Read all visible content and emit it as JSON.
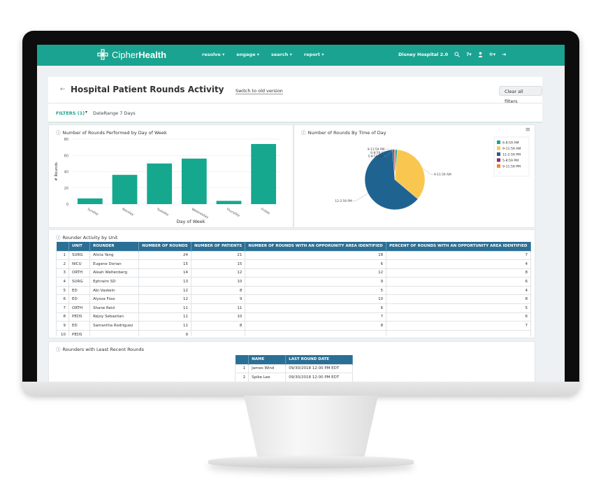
{
  "app": {
    "logo_prefix": "Cipher",
    "logo_suffix": "Health"
  },
  "nav": {
    "items": [
      "resolve ▾",
      "engage ▾",
      "search ▾",
      "report ▾"
    ],
    "org": "Disney Hospital 2.0"
  },
  "page": {
    "back_icon": "back-arrow-icon",
    "title": "Hospital Patient Rounds Activity",
    "switch_link": "Switch to old version",
    "clear_filters": "Clear all filters"
  },
  "filters": {
    "label": "FILTERS (1)",
    "daterange": "DateRange  7 Days"
  },
  "colors": {
    "brand": "#1aa390",
    "table_header": "#2a6f96"
  },
  "cards": {
    "day_of_week_title": "Number of Rounds Performed by Day of Week",
    "time_of_day_title": "Number of Rounds By Time of Day",
    "rounder_unit_title": "Rounder Activity by Unit",
    "least_recent_title": "Rounders with Least Recent Rounds"
  },
  "chart_data": [
    {
      "type": "bar",
      "title": "Number of Rounds Performed by Day of Week",
      "xlabel": "Day of Week",
      "ylabel": "# Rounds",
      "categories": [
        "Sunday",
        "Monday",
        "Tuesday",
        "Wednesday",
        "Thursday",
        "Friday"
      ],
      "values": [
        7,
        36,
        50,
        56,
        4,
        74
      ],
      "ylim": [
        0,
        80
      ],
      "yticks": [
        0,
        20,
        40,
        60,
        80
      ],
      "color": "#15a88f",
      "grid": true
    },
    {
      "type": "pie",
      "title": "Number of Rounds By Time of Day",
      "labels": [
        "6-8:59 AM",
        "9-11:59 AM",
        "12-2:59 PM",
        "5-8:59 PM",
        "9-11:59 PM"
      ],
      "values": [
        1,
        35,
        63,
        1,
        0.5
      ],
      "colors": [
        "#15a88f",
        "#f9c74f",
        "#1f6391",
        "#8e2a63",
        "#f08a24"
      ],
      "slice_labels": [
        "6-8:59 AM",
        "9-11:59 AM",
        "12-2:59 PM",
        "5-8:59 PM",
        "9-11:59 PM"
      ],
      "legend": "right"
    }
  ],
  "unit_table": {
    "headers": [
      "",
      "UNIT",
      "ROUNDER",
      "NUMBER OF ROUNDS",
      "NUMBER OF PATIENTS",
      "NUMBER OF ROUNDS WITH AN OPPORUNITY AREA IDENTIFIED",
      "PERCENT OF ROUNDS WITH AN OPPORTUNITY AREA IDENTIFIED"
    ],
    "rows": [
      [
        "1",
        "SURG",
        "Alicia Yang",
        "24",
        "21",
        "18",
        "7"
      ],
      [
        "2",
        "NICU",
        "Eugene Dorian",
        "15",
        "15",
        "6",
        "4"
      ],
      [
        "3",
        "ORTH",
        "Aleah Weltenberg",
        "14",
        "12",
        "12",
        "8"
      ],
      [
        "4",
        "SURG",
        "Ephraim SD",
        "13",
        "10",
        "9",
        "6"
      ],
      [
        "5",
        "ED",
        "Abi Vaskein",
        "12",
        "8",
        "5",
        "4"
      ],
      [
        "6",
        "ED",
        "Alyssa Foss",
        "12",
        "9",
        "10",
        "8"
      ],
      [
        "7",
        "ORTH",
        "Shane Reid",
        "11",
        "11",
        "6",
        "5"
      ],
      [
        "8",
        "PEDS",
        "Rejoy Sebastian",
        "11",
        "10",
        "7",
        "6"
      ],
      [
        "9",
        "ED",
        "Samantha Rodriguez",
        "11",
        "8",
        "8",
        "7"
      ],
      [
        "10",
        "PEDS",
        "",
        "9",
        "",
        "",
        ""
      ]
    ]
  },
  "least_recent_table": {
    "headers": [
      "",
      "NAME",
      "LAST ROUND DATE"
    ],
    "rows": [
      [
        "1",
        "James Wind",
        "09/30/2018 12:00 PM EDT"
      ],
      [
        "2",
        "Spike Lee",
        "09/30/2018 12:00 PM EDT"
      ]
    ]
  }
}
